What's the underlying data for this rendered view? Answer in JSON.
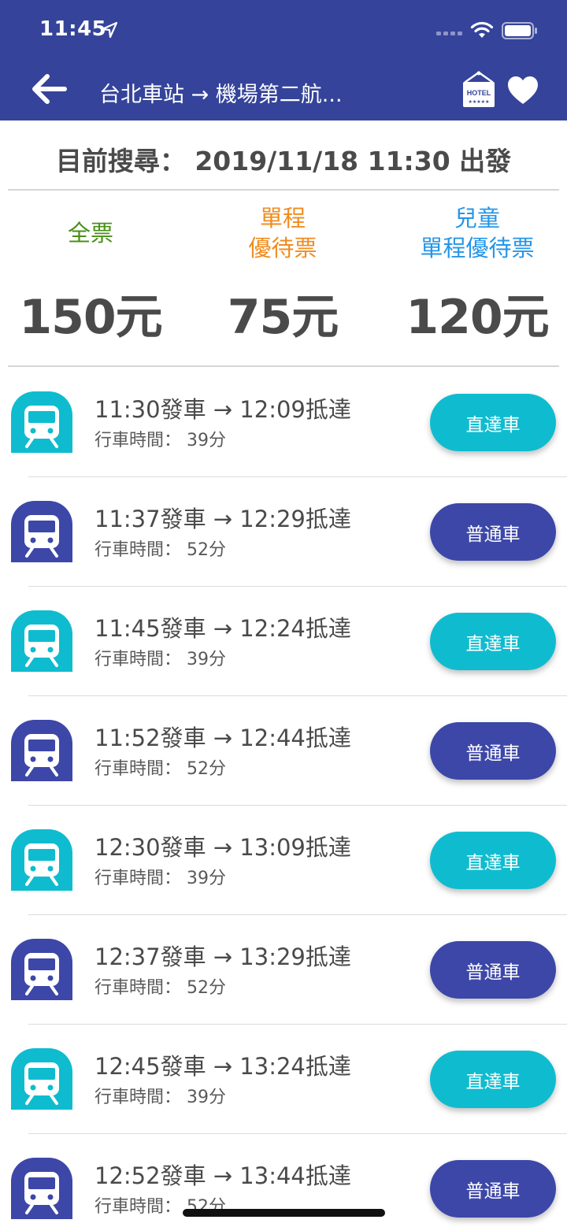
{
  "status_bar": {
    "time": "11:45"
  },
  "header": {
    "route_title": "台北車站 → 機場第二航...",
    "hotel_icon_text": "HOTEL"
  },
  "search": {
    "text": "目前搜尋： 2019/11/18 11:30 出發"
  },
  "fares": [
    {
      "label_lines": [
        "全票"
      ],
      "price": "150元",
      "color": "#4a8f1a"
    },
    {
      "label_lines": [
        "單程",
        "優待票"
      ],
      "price": "75元",
      "color": "#f08c1e"
    },
    {
      "label_lines": [
        "兒童",
        "單程優待票"
      ],
      "price": "120元",
      "color": "#2596e8"
    }
  ],
  "colors": {
    "header": "#35449a",
    "express": "#0fbccf",
    "local": "#3d47a8"
  },
  "trains": [
    {
      "times": "11:30發車 → 12:09抵達",
      "duration": "行車時間： 39分",
      "type": "直達車",
      "kind": "express"
    },
    {
      "times": "11:37發車 → 12:29抵達",
      "duration": "行車時間： 52分",
      "type": "普通車",
      "kind": "local"
    },
    {
      "times": "11:45發車 → 12:24抵達",
      "duration": "行車時間： 39分",
      "type": "直達車",
      "kind": "express"
    },
    {
      "times": "11:52發車 → 12:44抵達",
      "duration": "行車時間： 52分",
      "type": "普通車",
      "kind": "local"
    },
    {
      "times": "12:30發車 → 13:09抵達",
      "duration": "行車時間： 39分",
      "type": "直達車",
      "kind": "express"
    },
    {
      "times": "12:37發車 → 13:29抵達",
      "duration": "行車時間： 52分",
      "type": "普通車",
      "kind": "local"
    },
    {
      "times": "12:45發車 → 13:24抵達",
      "duration": "行車時間： 39分",
      "type": "直達車",
      "kind": "express"
    },
    {
      "times": "12:52發車 → 13:44抵達",
      "duration": "行車時間： 52分",
      "type": "普通車",
      "kind": "local"
    }
  ]
}
